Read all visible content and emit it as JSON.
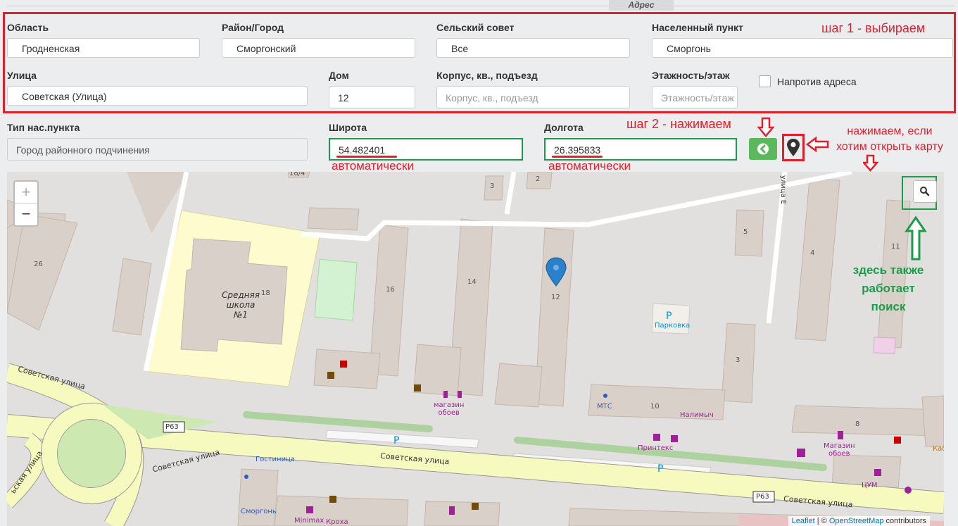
{
  "section": {
    "title": "Адрес"
  },
  "fields": {
    "oblast": {
      "label": "Область",
      "value": "Гродненская"
    },
    "rayon": {
      "label": "Район/Город",
      "value": "Сморгонский"
    },
    "selsovet": {
      "label": "Сельский совет",
      "value": "Все"
    },
    "punkt": {
      "label": "Населенный пункт",
      "value": "Сморгонь"
    },
    "ulica": {
      "label": "Улица",
      "value": "Советская (Улица)"
    },
    "dom": {
      "label": "Дом",
      "value": "12"
    },
    "korpus": {
      "label": "Корпус, кв., подъезд",
      "placeholder": "Корпус, кв., подъезд"
    },
    "etazh": {
      "label": "Этажность/этаж",
      "placeholder": "Этажность/этаж"
    },
    "naprotiv": {
      "label": "Напротив адреса",
      "checked": false
    },
    "tip": {
      "label": "Тип нас.пункта",
      "value": "Город районного подчинения"
    },
    "lat": {
      "label": "Широта",
      "value": "54.482401"
    },
    "lon": {
      "label": "Долгота",
      "value": "26.395833"
    }
  },
  "annotations": {
    "step1": "шаг 1 - выбираем",
    "step2": "шаг 2 - нажимаем",
    "auto_lat": "автоматически",
    "auto_lon": "автоматически",
    "map_hint_1": "нажимаем, если",
    "map_hint_2": "хотим открыть карту",
    "search_hint_1": "здесь также",
    "search_hint_2": "работает поиск"
  },
  "map": {
    "zoom_in": "+",
    "zoom_out": "−",
    "labels": {
      "school_1": "Средняя",
      "school_2": "школа",
      "school_3": "№1",
      "street_sov_1": "Советская улица",
      "street_sov_2": "Советская улица",
      "street_sov_3": "Советская улица",
      "street_sov_4": "Советская улица",
      "street_sov_5": "ьская улица",
      "street_ulica": "улица Е",
      "road_r63_1": "Р63",
      "road_r63_2": "Р63",
      "parking_label": "Парковка",
      "mts": "МТС",
      "nalimych": "Налимыч",
      "printeks": "Принтекс",
      "magazin_oboev_1a": "магазин",
      "magazin_oboev_1b": "обоев",
      "magazin_oboev_2a": "Магазин",
      "magazin_oboev_2b": "обоев",
      "gostinica": "Гостиница",
      "smorgon": "Сморгонь",
      "minimax": "Minimax",
      "kroha": "Кроха",
      "tsum": "ЦУМ",
      "kafe": "Каф",
      "p": "P",
      "n_26": "26",
      "n_18": "18",
      "n_18_4": "18/4",
      "n_3a": "3",
      "n_2": "2",
      "n_16": "16",
      "n_14": "14",
      "n_12": "12",
      "n_5": "5",
      "n_4": "4",
      "n_11": "11",
      "n_3b": "3",
      "n_10": "10",
      "n_8": "8"
    },
    "attribution": {
      "leaflet": "Leaflet",
      "sep": " | © ",
      "osm": "OpenStreetMap",
      "rest": " contributors"
    }
  },
  "colors": {
    "annotation_red": "#e0202d",
    "annotation_green": "#1c9b4a",
    "go_button": "#5cb85c",
    "marker": "#2a81cb"
  },
  "icons": {
    "go_button": "arrow-left-circle-icon",
    "map_button": "map-marker-icon",
    "search": "search-icon"
  }
}
